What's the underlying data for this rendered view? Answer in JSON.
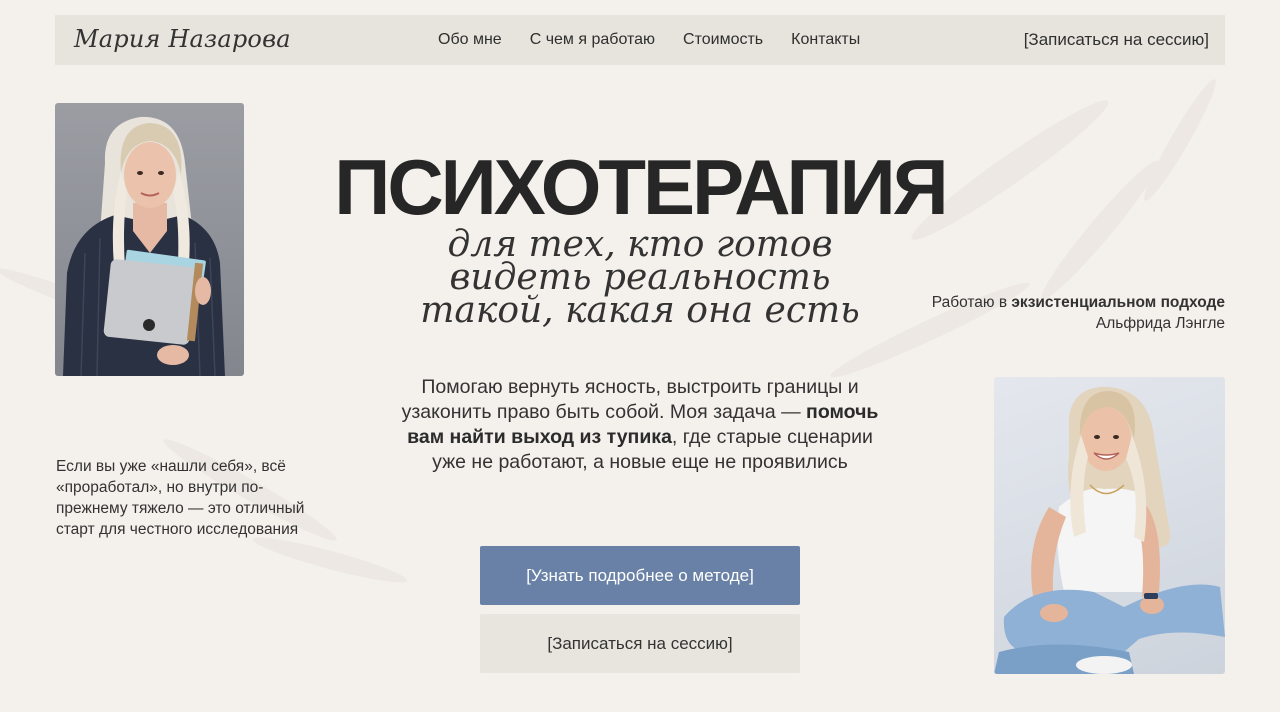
{
  "nav": {
    "brand": "Мария Назарова",
    "links": [
      "Обо мне",
      "С чем я работаю",
      "Стоимость",
      "Контакты"
    ],
    "cta": "[Записаться на сессию]"
  },
  "hero": {
    "title": "ПСИХОТЕРАПИЯ",
    "subtitle_lines": [
      "для тех, кто готов",
      "видеть реальность",
      "такой, какая она есть"
    ],
    "description": {
      "p1": "Помогаю вернуть ясность, выстроить границы и узаконить право быть собой.",
      "p2_prefix": "Моя задача — ",
      "p2_bold": "помочь вам найти выход из тупика",
      "p2_suffix": ", где старые сценарии уже не работают, а новые еще не проявились"
    }
  },
  "left_note": "Если вы уже «нашли себя», всё «проработал», но внутри по-прежнему тяжело — это отличный старт для честного исследования",
  "right_note": {
    "prefix": "Работаю в ",
    "bold": "экзистенциальном подходе",
    "suffix": " Альфрида Лэнгле"
  },
  "buttons": {
    "primary": "[Узнать подробнее о методе]",
    "secondary": "[Записаться на сессию]"
  },
  "colors": {
    "background": "#f4f0eb",
    "nav_bg": "#e6e4dc",
    "primary_button": "#6981a6",
    "secondary_button": "#e7e5dd"
  }
}
